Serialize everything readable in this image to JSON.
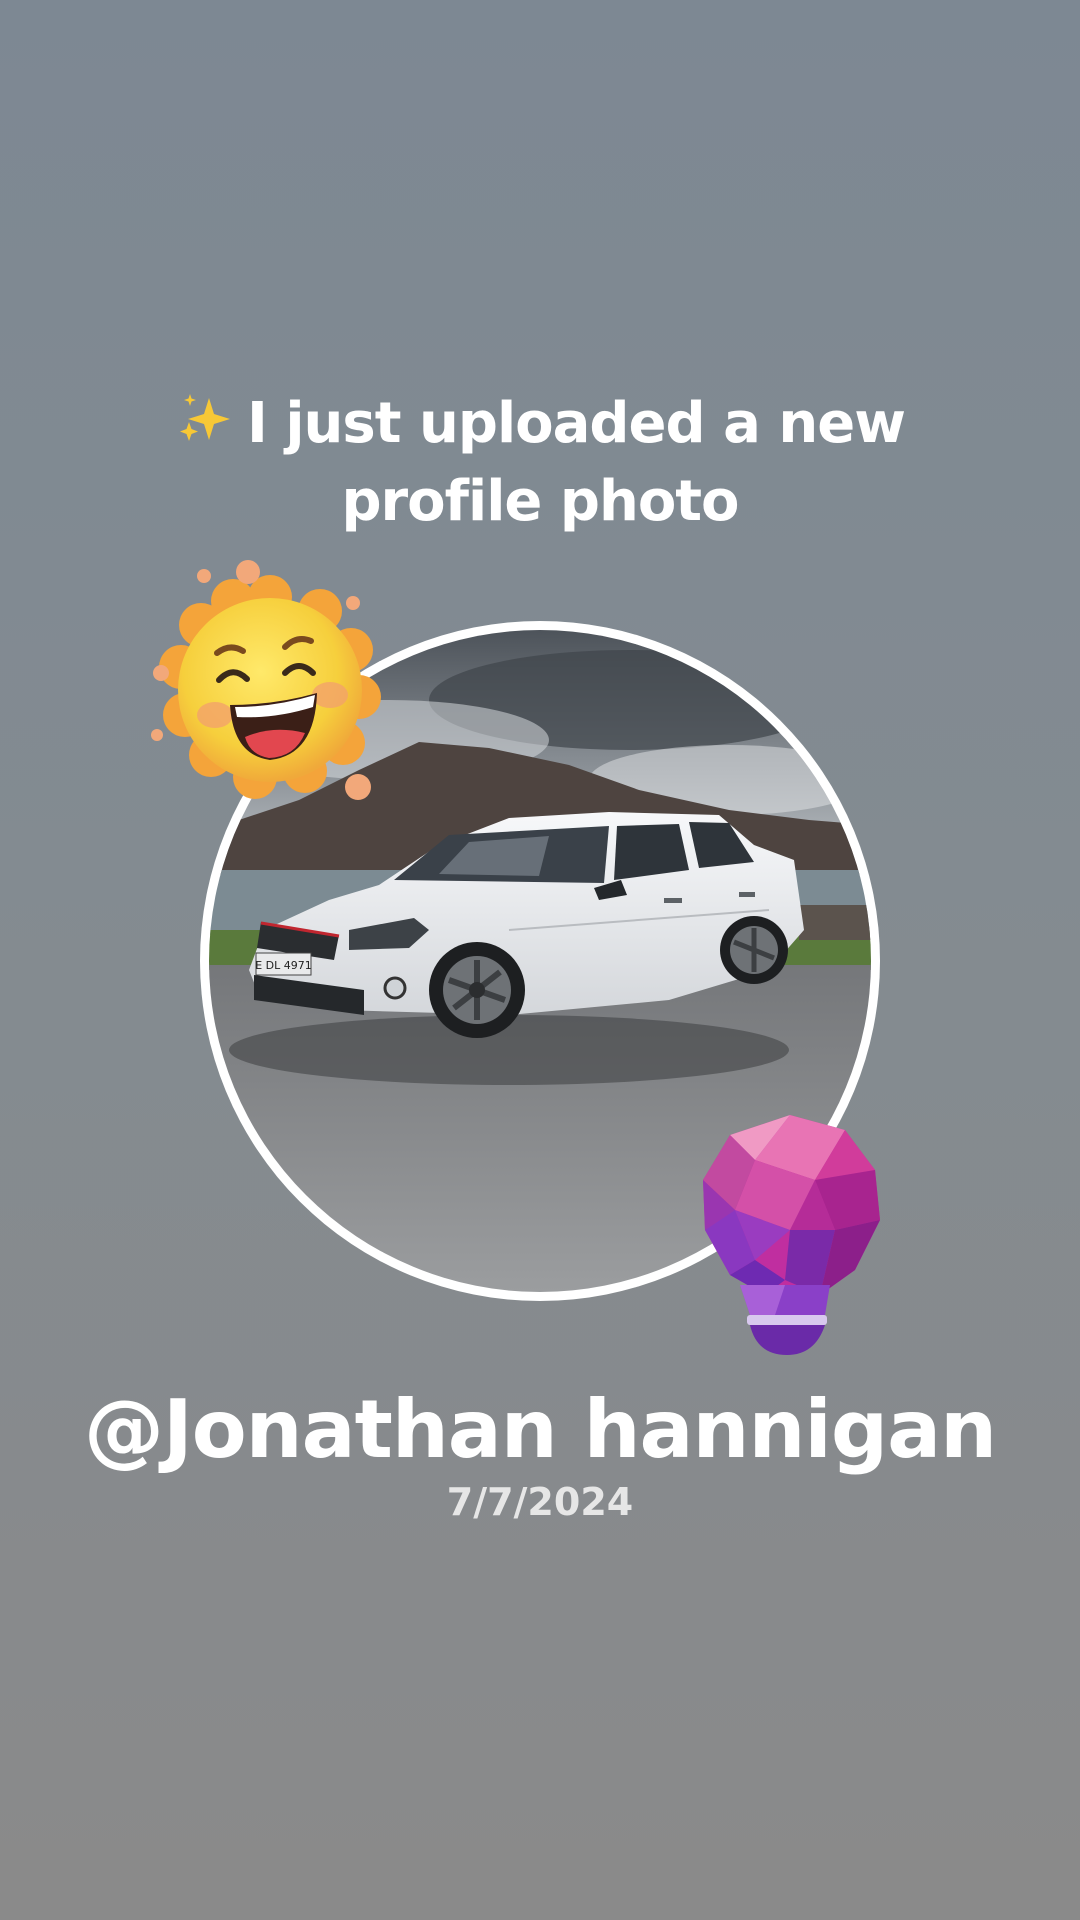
{
  "headline": {
    "sparkles_icon": "sparkles-icon",
    "text": "I just uploaded a new profile photo"
  },
  "profile": {
    "photo": "profile-photo",
    "username": "@Jonathan hannigan",
    "date": "7/7/2024",
    "plate_text": "E DL 4971"
  },
  "stickers": {
    "sun": "laughing-sun-sticker",
    "bulb": "lightbulb-sticker"
  },
  "colors": {
    "background_top": "#7d8893",
    "background_bottom": "#8a8a8a",
    "ring": "#ffffff",
    "text": "#ffffff",
    "bulb_accent": "#c02ea0"
  }
}
